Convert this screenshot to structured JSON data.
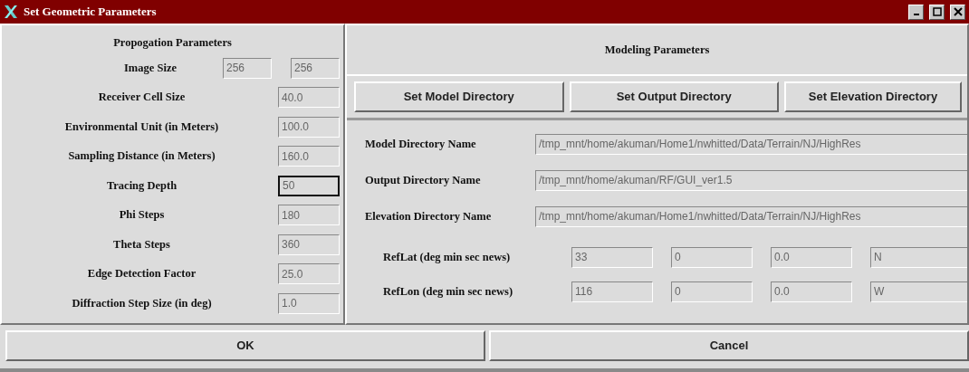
{
  "window": {
    "title": "Set Geometric Parameters"
  },
  "propagation": {
    "heading": "Propogation Parameters",
    "rows": [
      {
        "label": "Image Size",
        "fields": [
          {
            "value": "256",
            "focused": false
          },
          {
            "value": "256",
            "focused": false
          }
        ]
      },
      {
        "label": "Receiver Cell Size",
        "fields": [
          {
            "value": "40.0",
            "focused": false
          }
        ]
      },
      {
        "label": "Environmental Unit (in Meters)",
        "fields": [
          {
            "value": "100.0",
            "focused": false
          }
        ]
      },
      {
        "label": "Sampling Distance (in Meters)",
        "fields": [
          {
            "value": "160.0",
            "focused": false
          }
        ]
      },
      {
        "label": "Tracing Depth",
        "fields": [
          {
            "value": "50",
            "focused": true
          }
        ]
      },
      {
        "label": "Phi Steps",
        "fields": [
          {
            "value": "180",
            "focused": false
          }
        ]
      },
      {
        "label": "Theta Steps",
        "fields": [
          {
            "value": "360",
            "focused": false
          }
        ]
      },
      {
        "label": "Edge Detection Factor",
        "fields": [
          {
            "value": "25.0",
            "focused": false
          }
        ]
      },
      {
        "label": "Diffraction Step Size (in deg)",
        "fields": [
          {
            "value": "1.0",
            "focused": false
          }
        ]
      }
    ]
  },
  "modeling": {
    "heading": "Modeling Parameters",
    "buttons": [
      "Set Model Directory",
      "Set Output Directory",
      "Set Elevation Directory"
    ],
    "directories": [
      {
        "label": "Model Directory Name",
        "value": "/tmp_mnt/home/akuman/Home1/nwhitted/Data/Terrain/NJ/HighRes"
      },
      {
        "label": "Output Directory Name",
        "value": "/tmp_mnt/home/akuman/RF/GUI_ver1.5"
      },
      {
        "label": "Elevation Directory Name",
        "value": "/tmp_mnt/home/akuman/Home1/nwhitted/Data/Terrain/NJ/HighRes"
      }
    ],
    "refs": [
      {
        "label": "RefLat (deg min sec news)",
        "values": [
          "33",
          "0",
          "0.0",
          "N"
        ]
      },
      {
        "label": "RefLon (deg min sec news)",
        "values": [
          "116",
          "0",
          "0.0",
          "W"
        ]
      }
    ]
  },
  "buttons": [
    "OK",
    "Cancel"
  ]
}
